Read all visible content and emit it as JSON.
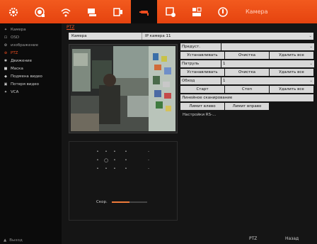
{
  "toolbar": {
    "title": "Камера",
    "icons": [
      "gear-icon",
      "record-icon",
      "network-icon",
      "user-icon",
      "display-icon",
      "camera-icon",
      "hdd-icon",
      "system-icon",
      "power-icon"
    ],
    "accent": "#ee4d1f"
  },
  "sidebar": {
    "items": [
      {
        "label": "Камера"
      },
      {
        "label": "OSD"
      },
      {
        "label": "изображение"
      },
      {
        "label": "PTZ"
      },
      {
        "label": "Движение"
      },
      {
        "label": "Маска"
      },
      {
        "label": "Подмена видео"
      },
      {
        "label": "Потеря видео"
      },
      {
        "label": "VCA"
      }
    ],
    "bottom_label": "Выход"
  },
  "main": {
    "breadcrumb": "PTZ",
    "camera_label": "Камера",
    "camera_value": "IP камера 11"
  },
  "ptz_settings": {
    "preset_label": "Предуст.",
    "preset_value": "",
    "btn_set": "Устанавливать",
    "btn_clear": "Очистка",
    "btn_delete_all": "Удалить все",
    "patrol_label": "Патруль",
    "patrol_value": "1",
    "pattern_label": "Обход",
    "pattern_value": "1",
    "btn_start": "Старт",
    "btn_stop": "Стоп",
    "linear_scan_label": "Линейное сканирование",
    "btn_left_limit": "Лимит влево",
    "btn_right_limit": "Лимит вправо",
    "rs_settings": "Настройки RS-..."
  },
  "ptz_control": {
    "speed_label": "Скор.",
    "speed_level": 0.5
  },
  "footer": {
    "ptz_button": "PTZ",
    "back_button": "Назад"
  }
}
